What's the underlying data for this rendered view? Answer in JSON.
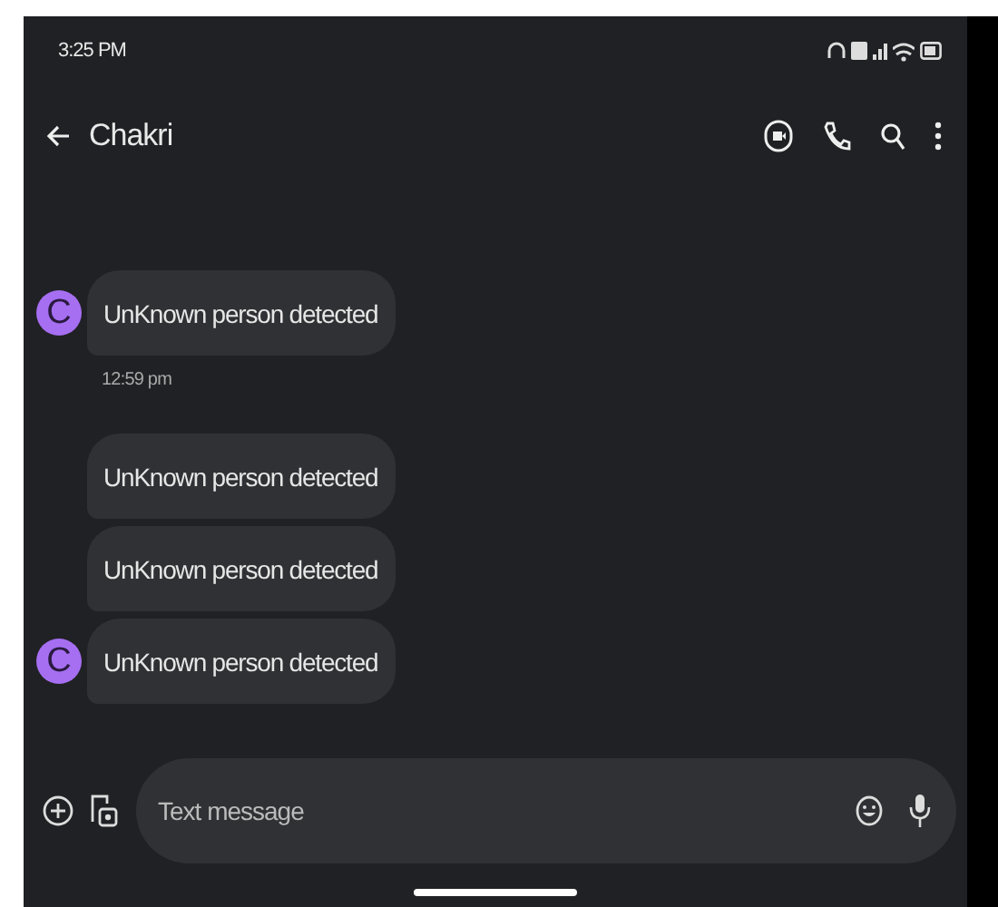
{
  "status_bar": {
    "time": "3:25 PM"
  },
  "header": {
    "title": "Chakri"
  },
  "contact": {
    "color": "#a66ff2"
  },
  "messages": [
    {
      "text": "UnKnown person detected",
      "avatar": "C",
      "time": "12:59 pm"
    },
    {
      "text": "UnKnown person detected"
    },
    {
      "text": "UnKnown person detected"
    },
    {
      "text": "UnKnown person detected",
      "avatar": "C"
    }
  ],
  "composer": {
    "placeholder": "Text message"
  }
}
